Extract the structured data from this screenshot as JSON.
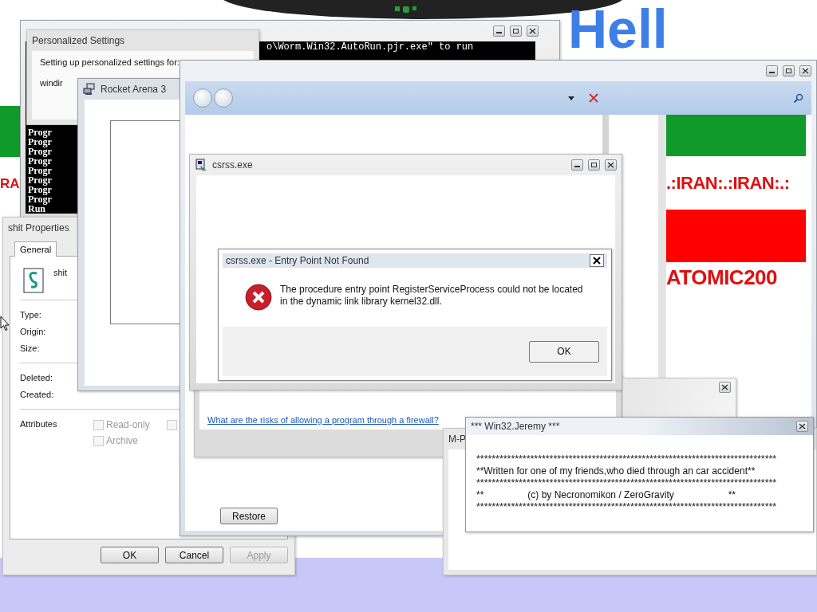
{
  "desktop": {
    "heading": "Hell",
    "left_banner_text": "RA"
  },
  "console_window": {
    "command_line": "o\\Worm.Win32.AutoRun.pjr.exe\" to run",
    "lines": [
      "Progr",
      "Progr",
      "Progr",
      "Progr",
      "Progr",
      "Progr",
      "Progr",
      "Progr",
      "Run"
    ]
  },
  "personalized_settings": {
    "title": "Personalized Settings",
    "message": "Setting up personalized settings for:",
    "item": "windir"
  },
  "properties": {
    "title": "shit Properties",
    "tabs": [
      {
        "label": "General",
        "selected": true
      }
    ],
    "file_name": "shit",
    "info_labels": [
      "Type:",
      "Origin:",
      "Size:"
    ],
    "date_labels": [
      "Deleted:",
      "Created:"
    ],
    "attributes_label": "Attributes",
    "checkboxes": [
      {
        "label": "Read-only",
        "checked": false,
        "disabled": true
      },
      {
        "label": "Archive",
        "checked": false,
        "disabled": true
      },
      {
        "checked": false,
        "disabled": true
      }
    ],
    "buttons": [
      {
        "label": "OK",
        "disabled": false
      },
      {
        "label": "Cancel",
        "disabled": false
      },
      {
        "label": "Apply",
        "disabled": true
      }
    ]
  },
  "rocket_arena": {
    "title": "Rocket Arena 3"
  },
  "explorer": {
    "flag_text": ".:IRAN:.:IRAN:.:",
    "banner_text": "ATOMIC200",
    "restore_button": "Restore"
  },
  "firewall_panel": {
    "link": "What are the risks of allowing a program through a firewall?"
  },
  "csrss_window": {
    "title": "csrss.exe"
  },
  "error_dialog": {
    "title": "csrss.exe - Entry Point Not Found",
    "message": "The procedure entry point RegisterServiceProcess could not be located in the dynamic link library kernel32.dll.",
    "button": "OK"
  },
  "mp_window": {
    "title": "M-P"
  },
  "jeremy_window": {
    "title": "*** Win32.Jeremy ***",
    "lines": [
      {
        "kind": "stars",
        "text": "******************************************************************************"
      },
      {
        "kind": "text",
        "text": "**Written for one of my friends,who died through an car accident**"
      },
      {
        "kind": "stars",
        "text": "******************************************************************************"
      },
      {
        "kind": "framed",
        "left": "**",
        "text": "(c) by Necronomikon / ZeroGravity",
        "right": "**"
      },
      {
        "kind": "stars",
        "text": "******************************************************************************"
      }
    ]
  }
}
